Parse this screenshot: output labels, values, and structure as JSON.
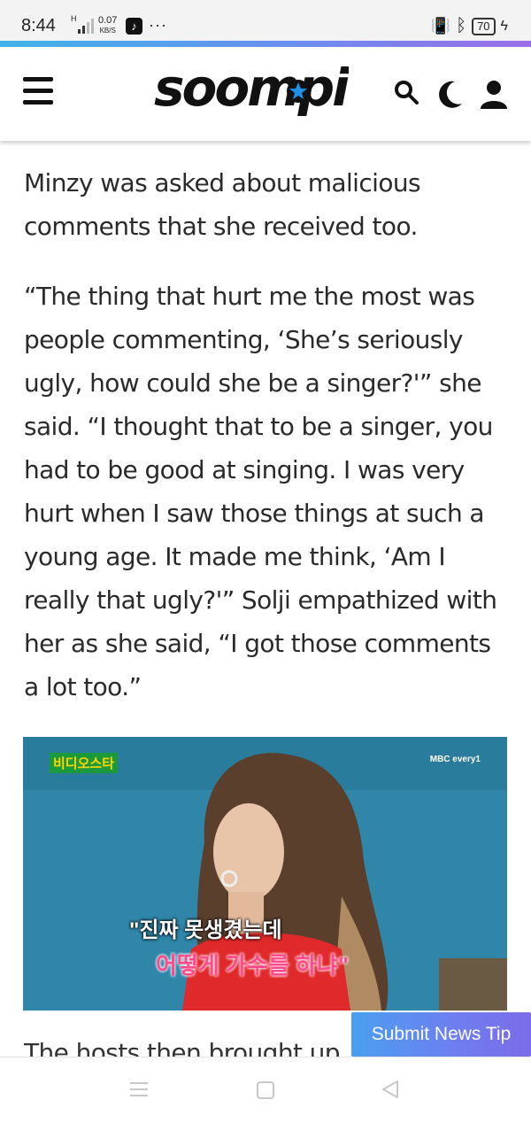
{
  "status_bar": {
    "time": "8:44",
    "network": "H",
    "speed_value": "0.07",
    "speed_unit": "KB/S",
    "more": "···",
    "battery": "70"
  },
  "header": {
    "logo_text": "soompi",
    "accent_color": "#1e90e6"
  },
  "article": {
    "paragraphs": [
      "Minzy was asked about malicious comments that she received too.",
      "“The thing that hurt me the most was people commenting, ‘She’s seriously ugly, how could she be a singer?'” she said. “I thought that to be a singer, you had to be good at singing. I was very hurt when I saw those things at such a young age. It made me think, ‘Am I really that ugly?'” Solji empathized with her as she said, “I got those comments a lot too.”"
    ],
    "photo": {
      "show_logo": "비디오스타",
      "channel": "MBC every1",
      "caption_line1": "\"진짜 못생겼는데",
      "caption_line2": "어떻게 가수를 하냐\""
    },
    "next_paragraph_partial": "The hosts then brought up"
  },
  "submit_tip_label": "Submit News Tip",
  "colors": {
    "progress_start": "#3fb3e8",
    "progress_end": "#9b6ee8",
    "tip_button": "#6f7df0",
    "photo_bg": "#2f86a8"
  }
}
